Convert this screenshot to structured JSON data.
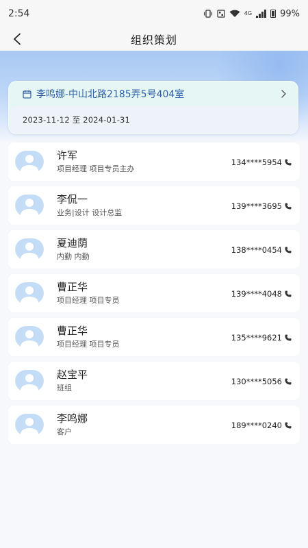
{
  "status_bar": {
    "time": "2:54",
    "network": "4G",
    "battery": "99%"
  },
  "header": {
    "title": "组织策划"
  },
  "project": {
    "address": "李鸣娜-中山北路2185弄5号404室",
    "date_range": "2023-11-12 至 2024-01-31"
  },
  "members": [
    {
      "name": "许军",
      "role": "项目经理 项目专员主办",
      "phone": "134****5954"
    },
    {
      "name": "李侃一",
      "role": "业务|设计 设计总监",
      "phone": "139****3695"
    },
    {
      "name": "夏迪荫",
      "role": "内勤 内勤",
      "phone": "138****0454"
    },
    {
      "name": "曹正华",
      "role": "项目经理 项目专员",
      "phone": "139****4048"
    },
    {
      "name": "曹正华",
      "role": "项目经理 项目专员",
      "phone": "135****9621"
    },
    {
      "name": "赵宝平",
      "role": "班组",
      "phone": "130****5056"
    },
    {
      "name": "李鸣娜",
      "role": "客户",
      "phone": "189****0240"
    }
  ],
  "icons": {
    "back": "back-arrow-icon",
    "calendar": "calendar-icon",
    "chevron": "chevron-right-icon",
    "phone": "phone-icon",
    "avatar": "avatar-placeholder-icon"
  },
  "colors": {
    "accent_text": "#2e5fa8",
    "hero_top": "#a9c9f3",
    "avatar": "#c5dcf7"
  }
}
